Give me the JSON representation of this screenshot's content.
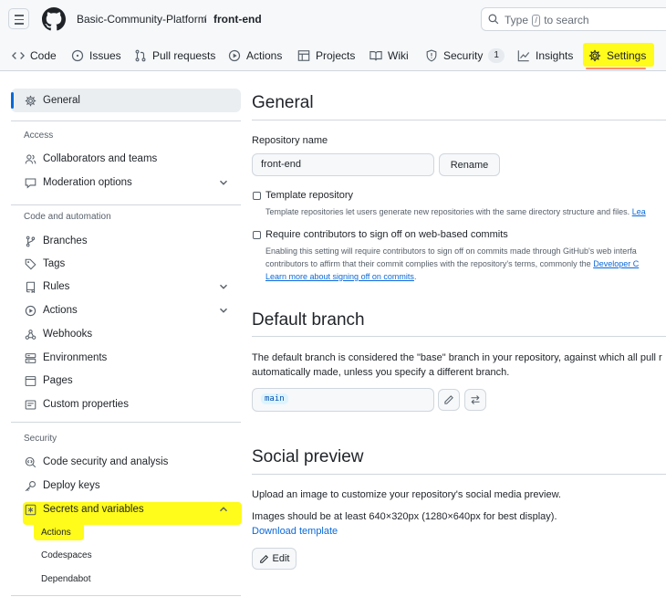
{
  "header": {
    "owner": "Basic-Community-Platform",
    "separator": "/",
    "repo": "front-end",
    "search_prefix": "Type",
    "search_key": "/",
    "search_suffix": "to search"
  },
  "repo_nav": [
    {
      "label": "Code",
      "icon": "code-icon"
    },
    {
      "label": "Issues",
      "icon": "issue-icon"
    },
    {
      "label": "Pull requests",
      "icon": "pull-request-icon"
    },
    {
      "label": "Actions",
      "icon": "play-icon"
    },
    {
      "label": "Projects",
      "icon": "table-icon"
    },
    {
      "label": "Wiki",
      "icon": "book-icon"
    },
    {
      "label": "Security",
      "icon": "shield-icon",
      "count": "1"
    },
    {
      "label": "Insights",
      "icon": "graph-icon"
    },
    {
      "label": "Settings",
      "icon": "gear-icon",
      "selected": true
    }
  ],
  "sidebar": {
    "general": "General",
    "access_heading": "Access",
    "collaborators": "Collaborators and teams",
    "moderation": "Moderation options",
    "code_heading": "Code and automation",
    "branches": "Branches",
    "tags": "Tags",
    "rules": "Rules",
    "actions": "Actions",
    "webhooks": "Webhooks",
    "environments": "Environments",
    "pages": "Pages",
    "custom_properties": "Custom properties",
    "security_heading": "Security",
    "code_security": "Code security and analysis",
    "deploy_keys": "Deploy keys",
    "secrets": "Secrets and variables",
    "sub_actions": "Actions",
    "sub_codespaces": "Codespaces",
    "sub_dependabot": "Dependabot"
  },
  "main": {
    "general_title": "General",
    "repo_name_label": "Repository name",
    "repo_name_value": "front-end",
    "rename_button": "Rename",
    "template_title": "Template repository",
    "template_desc": "Template repositories let users generate new repositories with the same directory structure and files.",
    "template_learn": "Lea",
    "signoff_title": "Require contributors to sign off on web-based commits",
    "signoff_desc1": "Enabling this setting will require contributors to sign off on commits made through GitHub's web interfa",
    "signoff_desc2": "contributors to affirm that their commit complies with the repository's terms, commonly the",
    "signoff_desc2_link": "Developer C",
    "signoff_learn": "Learn more about signing off on commits",
    "signoff_learn_end": ".",
    "default_branch_title": "Default branch",
    "default_branch_desc1": "The default branch is considered the \"base\" branch in your repository, against which all pull r",
    "default_branch_desc2": "automatically made, unless you specify a different branch.",
    "branch_value": "main",
    "social_title": "Social preview",
    "social_desc1": "Upload an image to customize your repository's social media preview.",
    "social_desc2": "Images should be at least 640×320px (1280×640px for best display).",
    "download_template": "Download template",
    "edit_button": "Edit"
  },
  "colors": {
    "accent": "#0969da",
    "highlight": "#fffb1a",
    "nav_underline": "#fd8c73"
  }
}
